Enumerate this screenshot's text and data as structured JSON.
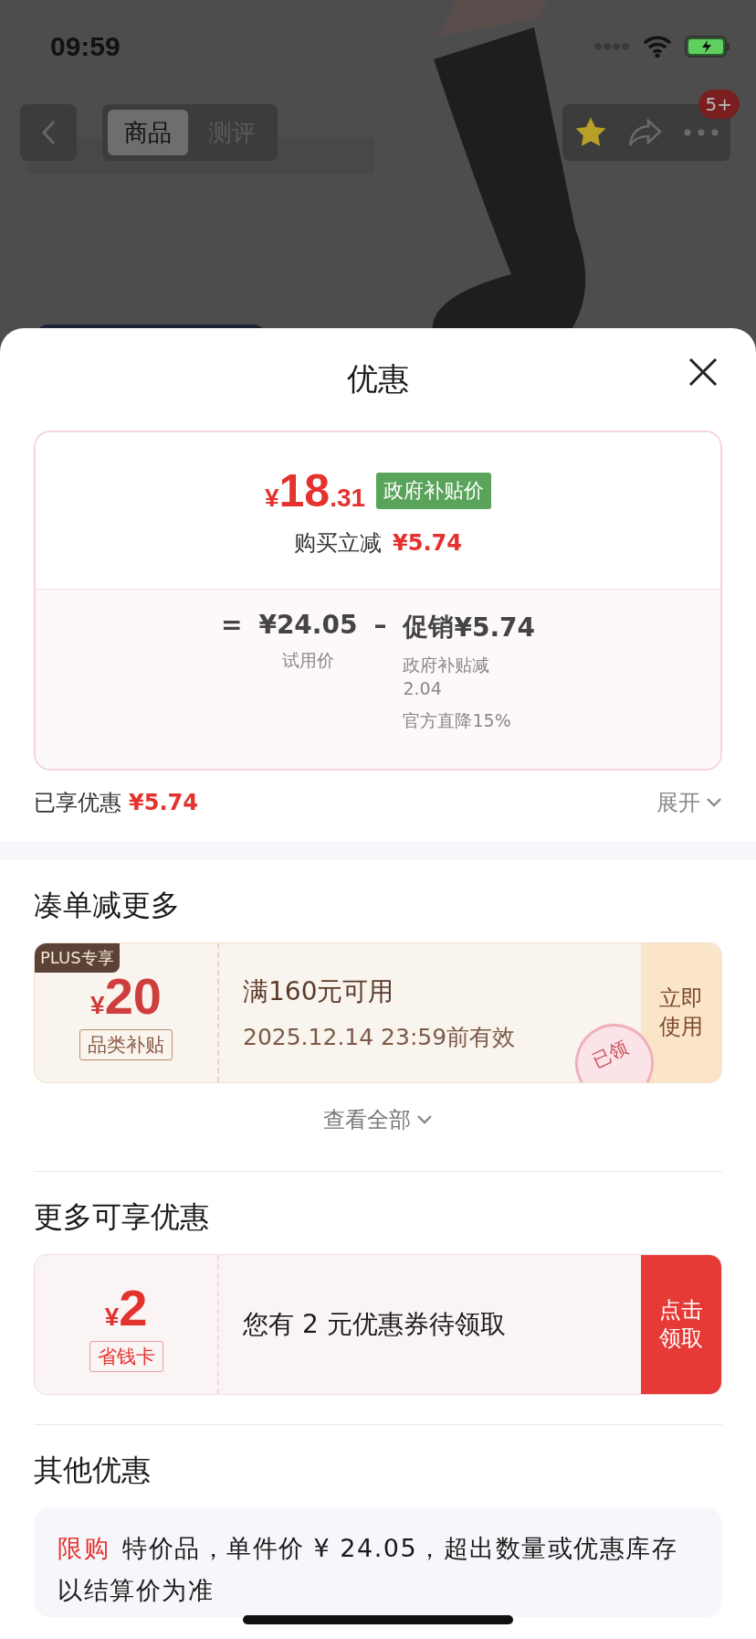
{
  "status_bar": {
    "time": "09:59"
  },
  "nav": {
    "tabs": [
      {
        "label": "商品",
        "selected": true
      },
      {
        "label": "测评",
        "selected": false
      }
    ],
    "badge": "5+"
  },
  "sheet": {
    "title": "优惠",
    "price_card": {
      "currency": "¥",
      "integer": "18",
      "decimal": ".31",
      "tag": "政府补贴价",
      "instant_label": "购买立减",
      "instant_amount": "¥5.74",
      "breakdown": {
        "equals": "=",
        "base_price": "¥24.05",
        "base_label": "试用价",
        "minus": "–",
        "promo_label": "促销",
        "promo_amount": "¥5.74",
        "details": [
          "政府补贴减2.04",
          "官方直降15%"
        ]
      }
    },
    "saved": {
      "label": "已享优惠",
      "amount": "¥5.74",
      "expand": "展开"
    },
    "sections": [
      {
        "title": "凑单减更多",
        "coupons": [
          {
            "kind": "plus",
            "badge": "PLUS专享",
            "currency": "¥",
            "amount": "20",
            "tag": "品类补贴",
            "lines": [
              "满160元可用",
              "2025.12.14 23:59前有效"
            ],
            "stamp": "已领",
            "action": "立即使用"
          }
        ],
        "view_all": "查看全部"
      },
      {
        "title": "更多可享优惠",
        "coupons": [
          {
            "kind": "card",
            "currency": "¥",
            "amount": "2",
            "tag": "省钱卡",
            "lines": [
              "您有 2 元优惠券待领取"
            ],
            "action": "点击领取"
          }
        ]
      }
    ],
    "other": {
      "title": "其他优惠",
      "notes": [
        {
          "tag": "限购",
          "text": "特价品，单件价 ¥ 24.05，超出数量或优惠库存以结算价为准"
        }
      ]
    }
  }
}
